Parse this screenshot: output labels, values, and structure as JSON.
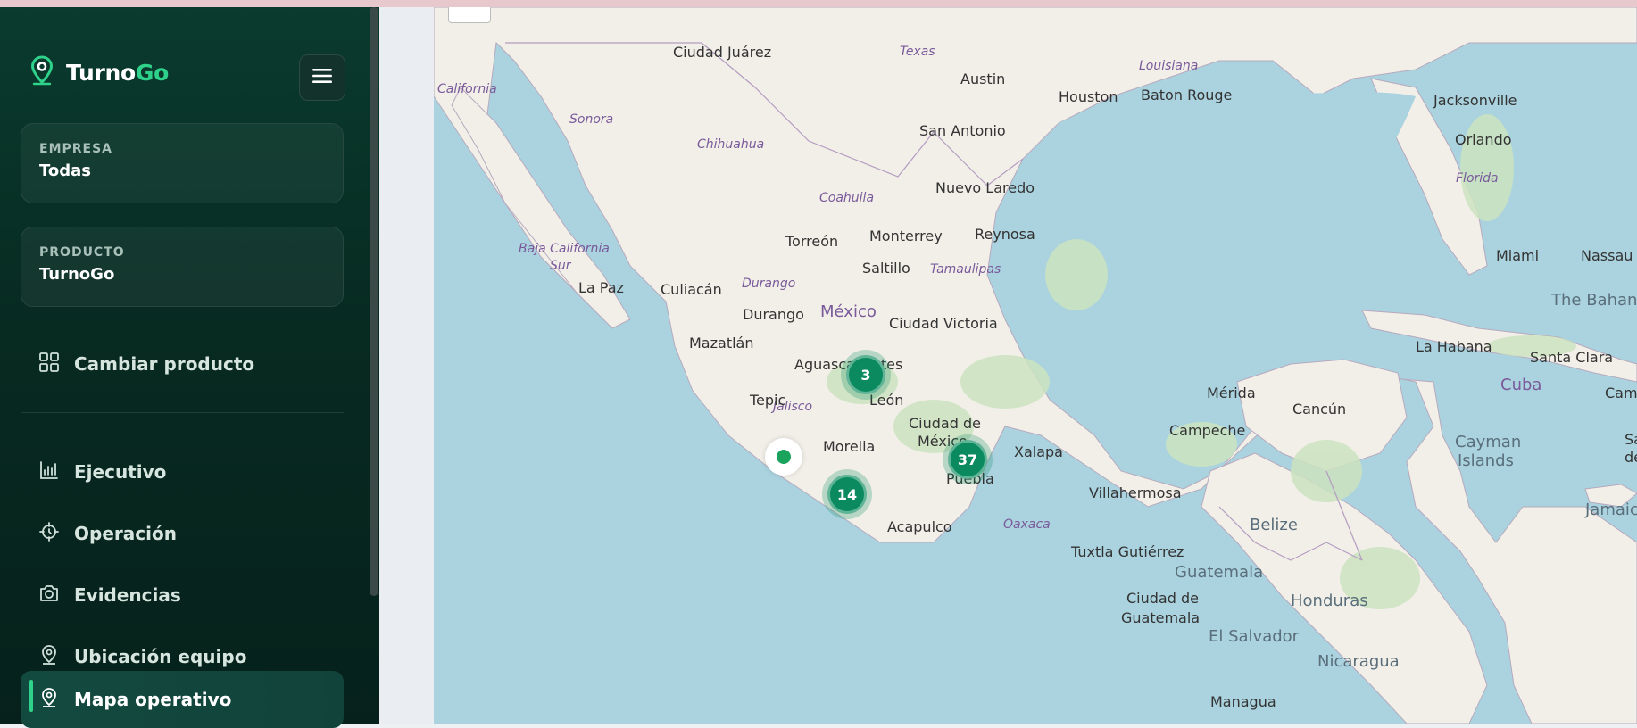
{
  "brand": {
    "name_part1": "Turno",
    "name_part2": "Go"
  },
  "filters": {
    "empresa": {
      "label": "EMPRESA",
      "value": "Todas"
    },
    "producto": {
      "label": "PRODUCTO",
      "value": "TurnoGo"
    }
  },
  "nav": {
    "cambiar_producto": "Cambiar producto",
    "items": [
      {
        "label": "Ejecutivo",
        "icon": "chart-icon"
      },
      {
        "label": "Operación",
        "icon": "target-icon"
      },
      {
        "label": "Evidencias",
        "icon": "camera-icon"
      },
      {
        "label": "Ubicación equipo",
        "icon": "map-pin-icon"
      },
      {
        "label": "Mapa operativo",
        "icon": "map-pin-icon",
        "active": true
      }
    ]
  },
  "map": {
    "clusters": [
      {
        "count": "3"
      },
      {
        "count": "37"
      },
      {
        "count": "14"
      }
    ],
    "labels": {
      "countries": [
        "México",
        "Cuba",
        "Belize",
        "Guatemala",
        "Honduras",
        "El Salvador",
        "Nicaragua",
        "Cayman",
        "Islands",
        "The Bahan",
        "Jamaica"
      ],
      "states": [
        "Texas",
        "Louisiana",
        "California",
        "Sonora",
        "Chihuahua",
        "Coahuila",
        "Baja California",
        "Sur",
        "Durango",
        "Tamaulipas",
        "Jalisco",
        "Florida",
        "Oaxaca"
      ],
      "cities": [
        "Ciudad Juárez",
        "Austin",
        "Houston",
        "Baton Rouge",
        "Jacksonville",
        "San Antonio",
        "Orlando",
        "Nuevo Laredo",
        "Monterrey",
        "Reynosa",
        "Torreón",
        "Saltillo",
        "Miami",
        "Nassau",
        "La Paz",
        "Culiacán",
        "Durango",
        "Ciudad Victoria",
        "Mazatlán",
        "Aguascalientes",
        "La Habana",
        "Santa Clara",
        "Tepic",
        "León",
        "Mérida",
        "Cancún",
        "Ciudad de",
        "México",
        "Campeche",
        "Morelia",
        "Xalapa",
        "Puebla",
        "Villahermosa",
        "Acapulco",
        "Tuxtla Gutiérrez",
        "Ciudad de",
        "Guatemala",
        "Managua",
        "Cama",
        "Sa",
        "de"
      ]
    }
  }
}
